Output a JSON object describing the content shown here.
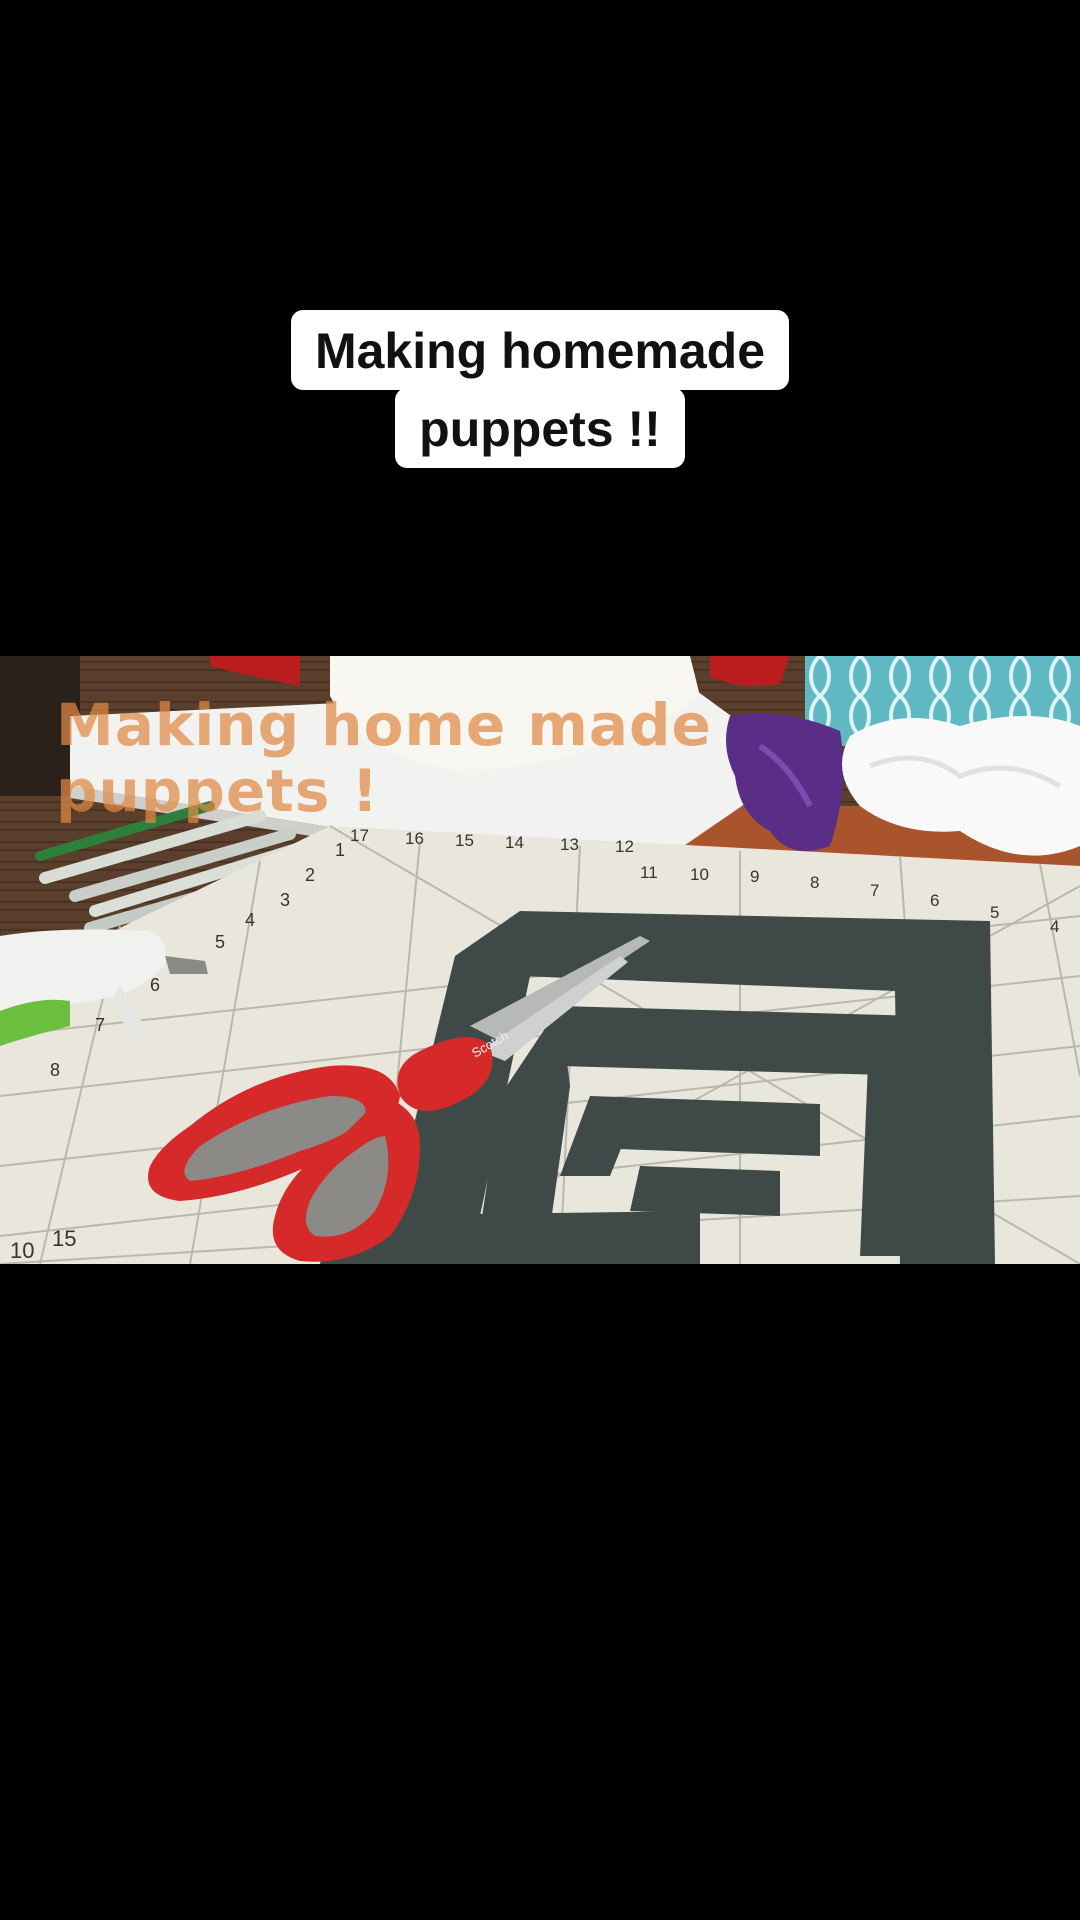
{
  "caption": {
    "line1": "Making homemade",
    "line2": "puppets !!"
  },
  "video": {
    "overlay_line1": "Making home made",
    "overlay_line2": "puppets !",
    "scissors_brand": "Scotch",
    "ruler_top_numbers": [
      "17",
      "16",
      "15",
      "14",
      "13",
      "12",
      "11",
      "10",
      "9",
      "8",
      "7",
      "6",
      "5",
      "4"
    ],
    "ruler_left_numbers": [
      "1",
      "2",
      "3",
      "4",
      "5",
      "6",
      "7",
      "8"
    ],
    "ruler_bottom_numbers": [
      "10",
      "15"
    ]
  },
  "colors": {
    "background": "#000000",
    "caption_bg": "#ffffff",
    "overlay_text": "#e08a45",
    "mat_light": "#e9e7dc",
    "mat_dark": "#3f4a48",
    "scissors_red": "#d62a2a",
    "scissors_grey": "#8c8a86"
  }
}
